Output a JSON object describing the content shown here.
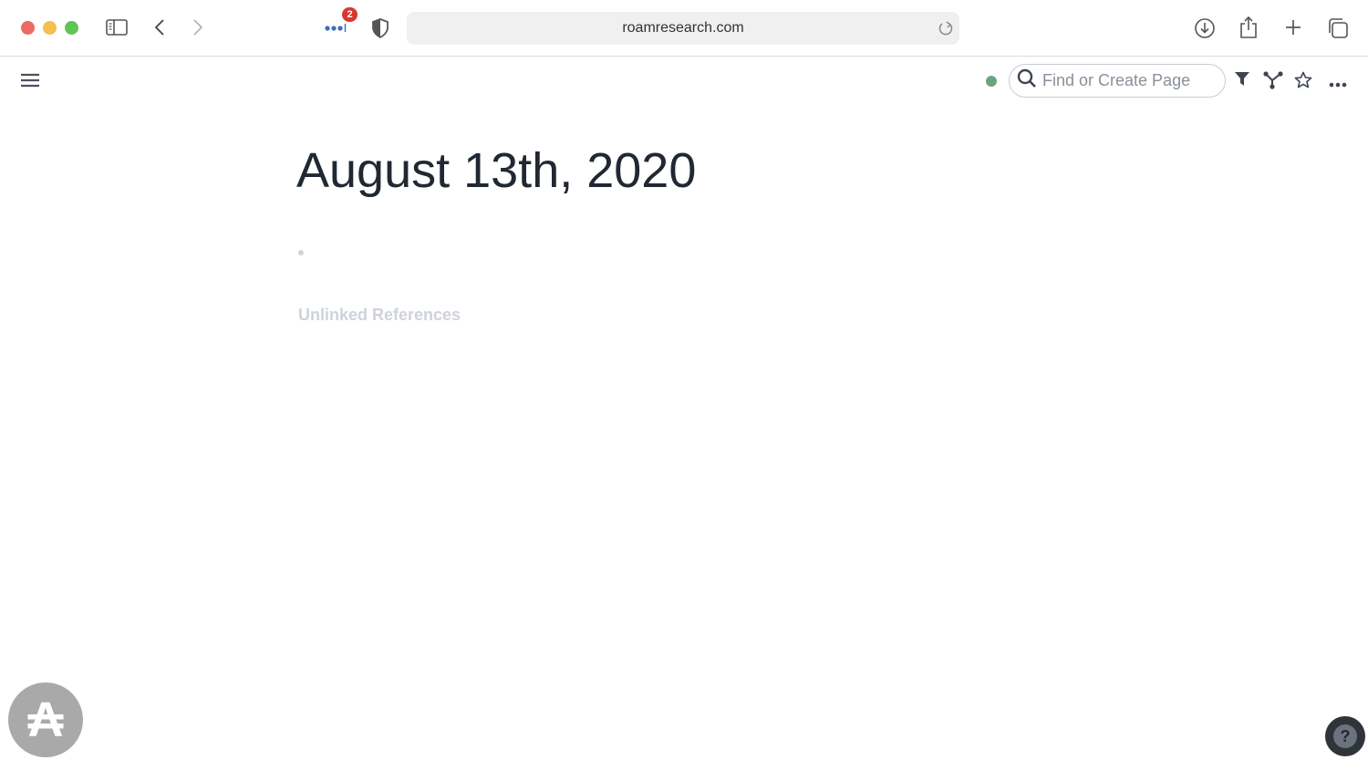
{
  "browser": {
    "url": "roamresearch.com",
    "extension_badge_count": "2",
    "icons": {
      "sidebar": "sidebar-icon",
      "back": "chevron-left-icon",
      "forward": "chevron-right-icon",
      "extensions": "dots-extension-icon",
      "privacy": "shield-icon",
      "reload": "reload-icon",
      "downloads": "download-icon",
      "share": "share-icon",
      "new_tab": "plus-icon",
      "tab_overview": "tabs-icon"
    }
  },
  "app": {
    "search": {
      "placeholder": "Find or Create Page",
      "value": ""
    },
    "sync_status_color": "#6ca57d",
    "toolbar_icons": [
      "filter-icon",
      "graph-icon",
      "star-icon",
      "more-icon"
    ]
  },
  "page": {
    "title": "August 13th, 2020",
    "blocks": [
      ""
    ],
    "unlinked_references_label": "Unlinked References"
  },
  "floating": {
    "extension_glyph": "₳",
    "help_glyph": "?"
  }
}
